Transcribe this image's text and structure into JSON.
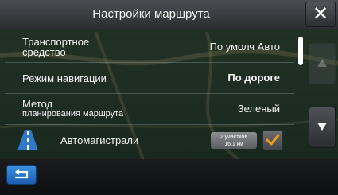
{
  "header": {
    "title": "Настройки маршрута",
    "close_label": "✕"
  },
  "settings": [
    {
      "label": "Транспортное",
      "sublabel": "средство",
      "value": "По умолч Авто"
    },
    {
      "label": "Режим навигации",
      "value": "По дороге"
    },
    {
      "label": "Метод",
      "sublabel": "планирования маршрута",
      "value": "Зеленый"
    },
    {
      "label": "Автомагистрали",
      "badge_line1": "2 участков",
      "badge_line2": "16.1 км",
      "checked": true
    }
  ],
  "colors": {
    "accent": "#f39a1a",
    "back_button": "#2a78c9",
    "scrollbar": "#ffffff"
  },
  "icons": {
    "highway": "highway-icon",
    "back": "back-arrow-icon",
    "scroll_up": "triangle-up-icon",
    "scroll_down": "triangle-down-icon",
    "close": "close-icon",
    "check": "checkmark-icon"
  }
}
